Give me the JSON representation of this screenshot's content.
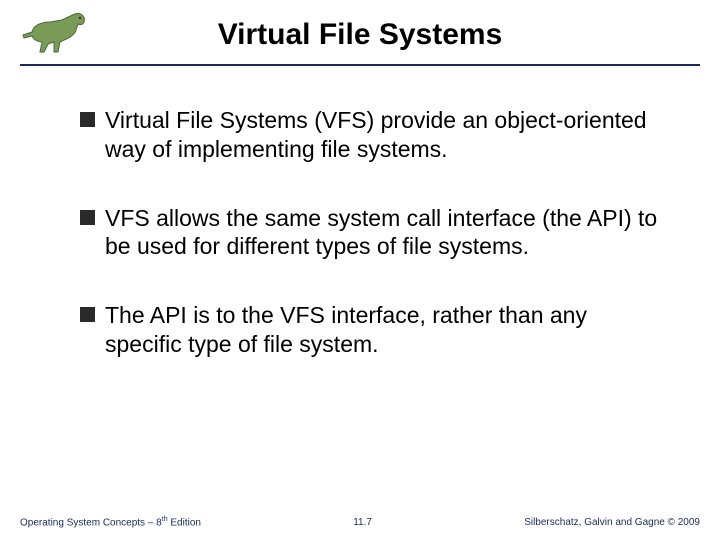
{
  "title": "Virtual File Systems",
  "bullets": [
    "Virtual File Systems (VFS) provide an object-oriented way of implementing file systems.",
    "VFS allows the same system call interface (the API) to be used for different types of file systems.",
    "The API is to the VFS interface, rather than any specific type of file system."
  ],
  "footer": {
    "left_prefix": "Operating System Concepts – 8",
    "left_super": "th",
    "left_suffix": " Edition",
    "center": "11.7",
    "right": "Silberschatz, Galvin and Gagne © 2009"
  },
  "icon_name": "dinosaur-icon",
  "colors": {
    "rule": "#1a2a5a",
    "bullet": "#2a2a2a",
    "footer_text": "#1a2a5a"
  }
}
